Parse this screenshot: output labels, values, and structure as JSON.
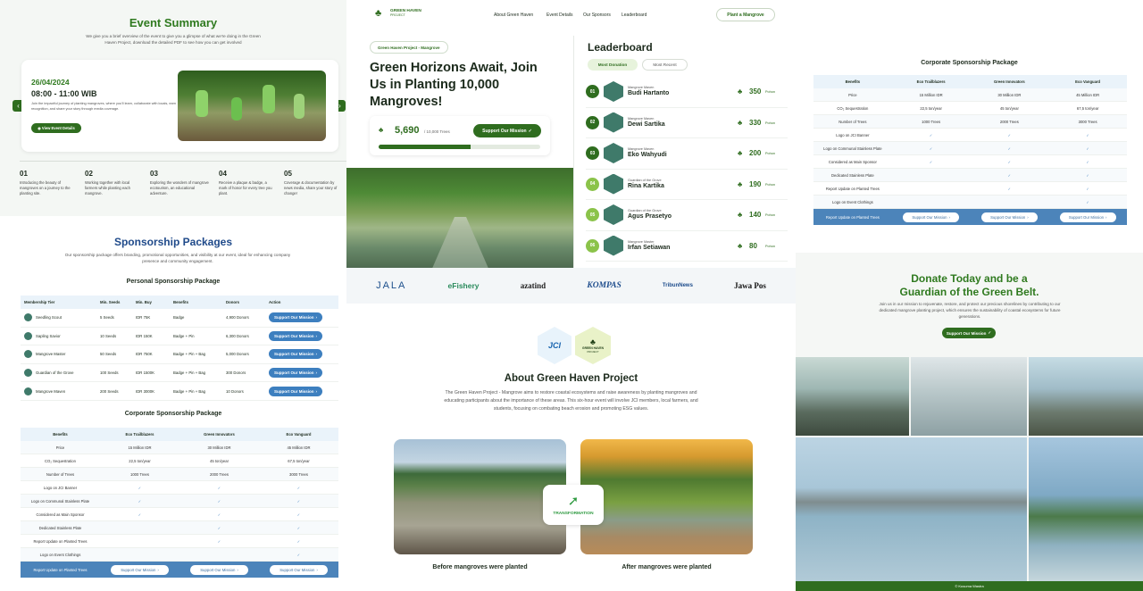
{
  "event": {
    "title": "Event Summary",
    "subtitle": "We give you a brief overview of the event to give you a glimpse of what we're doing in the Green Haven Project, download the detailed PDF to see how you can get involved",
    "date": "26/04/2024",
    "time": "08:00 - 11:00 WIB",
    "description": "Join the impactful journey of planting mangroves, where you'll learn, collaborate with locals, earn recognition, and share your story through media coverage.",
    "details_button": "View Event Details",
    "steps": [
      {
        "num": "01",
        "text": "Introducing the beauty of mangroves on a journey to the planting site."
      },
      {
        "num": "02",
        "text": "Working together with local farmers while planting each mangrove."
      },
      {
        "num": "03",
        "text": "Exploring the wonders of mangrove ecotourism, an educational adventure."
      },
      {
        "num": "04",
        "text": "Receive a plaque & badge, a mark of honor for every tree you plant."
      },
      {
        "num": "05",
        "text": "Coverage & documentation by news media, share your story of change!"
      }
    ]
  },
  "sponsorship": {
    "title": "Sponsorship Packages",
    "subtitle": "Our sponsorship package offers branding, promotional opportunities, and visibility at our event, ideal for enhancing company presence and community engagement.",
    "personal_title": "Personal Sponsorship Package",
    "personal_headers": [
      "Membership Tier",
      "Min. Seeds",
      "Min. Buy",
      "Benefits",
      "Donors",
      "Action"
    ],
    "personal_rows": [
      {
        "tier": "Seedling Scout",
        "seeds": "5 Seeds",
        "buy": "IDR 75K",
        "benefits": "Badge",
        "donors": "4,900 Donors",
        "action": "Support Our Mission"
      },
      {
        "tier": "Sapling Savior",
        "seeds": "10 Seeds",
        "buy": "IDR 150K",
        "benefits": "Badge + Pin",
        "donors": "6,300 Donors",
        "action": "Support Our Mission"
      },
      {
        "tier": "Mangrove Master",
        "seeds": "50 Seeds",
        "buy": "IDR 750K",
        "benefits": "Badge + Pin + Bag",
        "donors": "5,000 Donors",
        "action": "Support Our Mission"
      },
      {
        "tier": "Guardian of the Grove",
        "seeds": "100 Seeds",
        "buy": "IDR 1500K",
        "benefits": "Badge + Pin + Bag",
        "donors": "300 Donors",
        "action": "Support Our Mission"
      },
      {
        "tier": "Mangrove Maven",
        "seeds": "200 Seeds",
        "buy": "IDR 3000K",
        "benefits": "Badge + Pin + Bag",
        "donors": "10 Donors",
        "action": "Support Our Mission"
      }
    ],
    "corporate_title": "Corporate Sponsorship Package",
    "corporate_headers": [
      "Benefits",
      "Eco Trailblazers",
      "Green Innovators",
      "Eco Vanguard"
    ],
    "corporate_rows": [
      [
        "Price",
        "15 Million IDR",
        "30 Million IDR",
        "45 Million IDR"
      ],
      [
        "CO₂ Sequestration",
        "22,5 ton/year",
        "45 ton/year",
        "67,5 ton/year"
      ],
      [
        "Number of Trees",
        "1000 Trees",
        "2000 Trees",
        "3000 Trees"
      ],
      [
        "Logo on JCI Banner",
        "✓",
        "✓",
        "✓"
      ],
      [
        "Logo on Communal Stainless Plate",
        "✓",
        "✓",
        "✓"
      ],
      [
        "Considered as Main Sponsor",
        "✓",
        "✓",
        "✓"
      ],
      [
        "Dedicated Stainless Plate",
        "",
        "✓",
        "✓"
      ],
      [
        "Report Update on Planted Trees",
        "",
        "✓",
        "✓"
      ],
      [
        "Logo on Event Clothings",
        "",
        "",
        "✓"
      ]
    ],
    "corporate_footer_label": "Report Update on Planted Trees",
    "corporate_footer_button": "Support Our Mission"
  },
  "nav": {
    "brand_line1": "GREEN HAVEN",
    "brand_line2": "PROJECT",
    "links": [
      "About Green Haven",
      "Event Details",
      "Our Sponsors",
      "Leaderboard"
    ],
    "cta": "Plant a Mangrove"
  },
  "hero": {
    "tag": "Green Haven Project - Mangrove",
    "title": "Green Horizons Await, Join Us in Planting 10,000 Mangroves!",
    "count": "5,690",
    "goal": "/ 10,000 Trees",
    "progress": 0.569,
    "cta": "Support Our Mission"
  },
  "leaderboard": {
    "title": "Leaderboard",
    "tabs": [
      "Most Donation",
      "Most Recent"
    ],
    "unit": "Pohon",
    "entries": [
      {
        "rank": "01",
        "tier": "Mangrove Maven",
        "name": "Budi Hartanto",
        "count": "350"
      },
      {
        "rank": "02",
        "tier": "Mangrove Maven",
        "name": "Dewi Sartika",
        "count": "330"
      },
      {
        "rank": "03",
        "tier": "Mangrove Maven",
        "name": "Eko Wahyudi",
        "count": "200"
      },
      {
        "rank": "04",
        "tier": "Guardian of the Grove",
        "name": "Rina Kartika",
        "count": "190"
      },
      {
        "rank": "05",
        "tier": "Guardian of the Grove",
        "name": "Agus Prasetyo",
        "count": "140"
      },
      {
        "rank": "06",
        "tier": "Mangrove Master",
        "name": "Irfan Setiawan",
        "count": "80"
      }
    ]
  },
  "sponsors": [
    "JALA",
    "eFishery",
    "azatind",
    "KOMPAS",
    "TribunNews",
    "Jawa Pos"
  ],
  "about": {
    "jci": "JCI",
    "badge_line1": "GREEN HAVEN",
    "badge_line2": "PROJECT",
    "title": "About Green Haven Project",
    "text": "The Green Haven Project - Mangrove aims to restore coastal ecosystems and raise awareness by planting mangroves and educating participants about the importance of these areas. This six-hour event will involve JCI members, local farmers, and students, focusing on combating beach erosion and promoting ESG values.",
    "transformation": "TRANSFORMATION",
    "before": "Before mangroves were planted",
    "after": "After mangroves were planted"
  },
  "donate": {
    "title_line1": "Donate Today and be a",
    "title_line2": "Guardian of the Green Belt.",
    "text": "Join us in our mission to rejuvenate, restore, and protect our precious shorelines by contributing to our dedicated mangrove planting project, which ensures the sustainability of coastal ecosystems for future generations.",
    "cta": "Support Our Mission",
    "credit": "© Kusuma Wastra"
  },
  "colors": {
    "primary": "#2f6d1f",
    "accent_blue": "#3d7fbf",
    "light_green": "#8bc34a"
  }
}
